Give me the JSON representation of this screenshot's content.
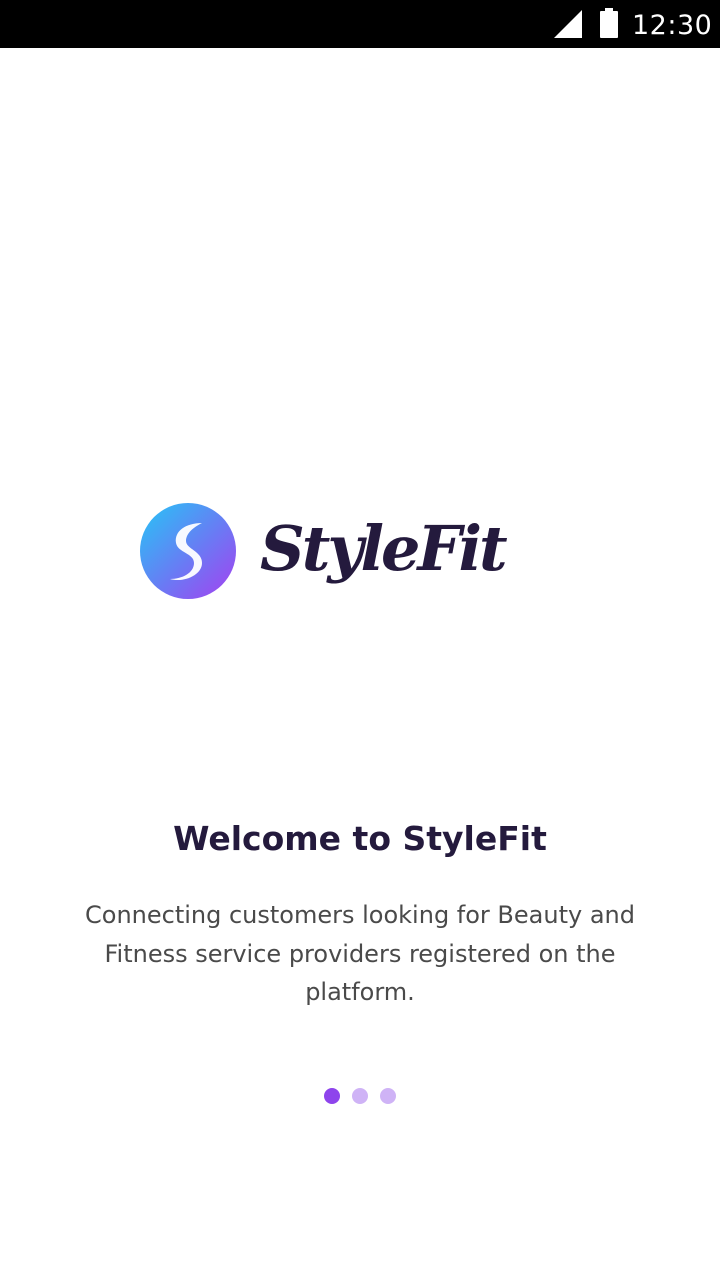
{
  "status_bar": {
    "time": "12:30",
    "icons": [
      "signal-icon",
      "battery-icon"
    ]
  },
  "logo": {
    "text": "StyleFit",
    "icon": "stylefit-s-logo-icon"
  },
  "onboarding": {
    "title": "Welcome to StyleFit",
    "description": "Connecting customers looking for Beauty and Fitness service providers registered on the platform."
  },
  "pager": {
    "count": 3,
    "active_index": 0
  },
  "colors": {
    "brand_dark": "#241a3d",
    "accent_purple": "#8e44ec",
    "dot_inactive": "#cfb3f6",
    "gradient_start": "#25c6f6",
    "gradient_end": "#a63ff0"
  }
}
